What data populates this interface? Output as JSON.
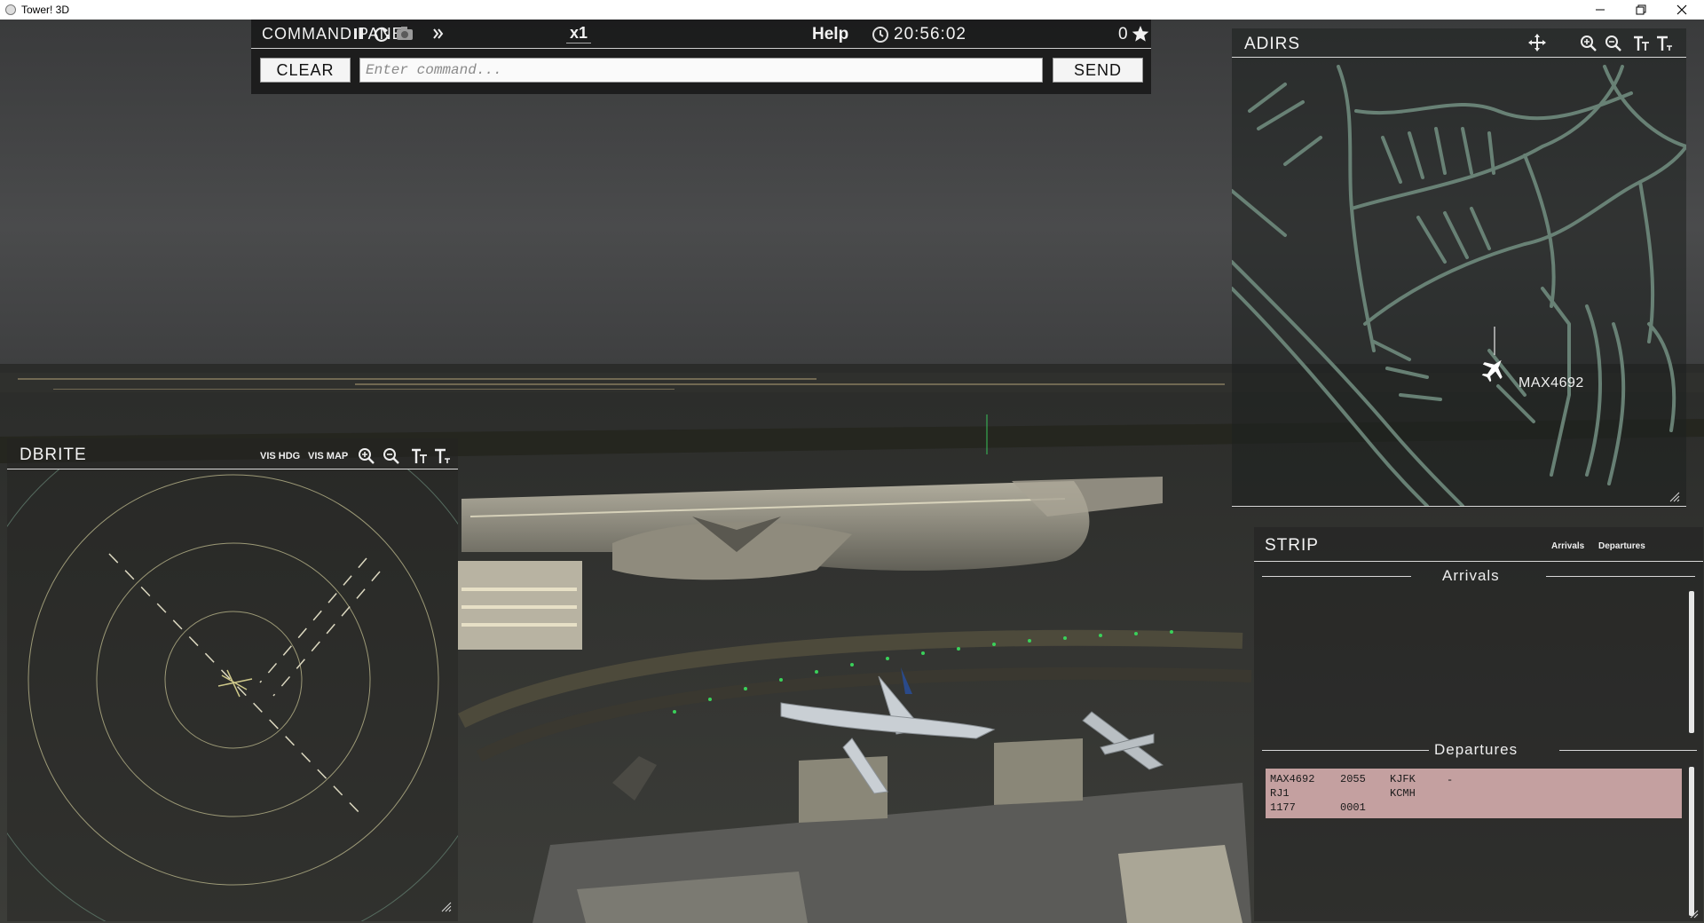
{
  "window": {
    "title": "Tower! 3D",
    "controls": [
      "minimize-icon",
      "restore-icon",
      "close-icon"
    ]
  },
  "command_panel": {
    "title": "COMMAND PANEL",
    "speed": "x1",
    "help_label": "Help",
    "time": "20:56:02",
    "score": "0",
    "clear_label": "CLEAR",
    "send_label": "SEND",
    "input_placeholder": "Enter command...",
    "input_value": ""
  },
  "dbrite": {
    "title": "DBRITE",
    "vis_hdg_label": "VIS HDG",
    "vis_map_label": "VIS MAP",
    "tools": [
      "zoom-in-icon",
      "zoom-out-icon",
      "text-larger-icon",
      "text-smaller-icon"
    ]
  },
  "adirs": {
    "title": "ADIRS",
    "tools": [
      "move-icon",
      "zoom-in-icon",
      "zoom-out-icon",
      "text-larger-icon",
      "text-smaller-icon"
    ],
    "aircraft_label": "MAX4692"
  },
  "strip": {
    "title": "STRIP",
    "tab_arrivals": "Arrivals",
    "tab_departures": "Departures",
    "arrivals_header": "Arrivals",
    "departures_header": "Departures",
    "departures": [
      {
        "callsign": "MAX4692",
        "time": "2055",
        "origin": "KJFK",
        "remark": "-",
        "type": "RJ1",
        "destination": "KCMH",
        "squawk": "1177",
        "code": "0001"
      }
    ]
  },
  "colors": {
    "panel_bg": "#161616",
    "strip_bg": "#c4a0a0",
    "map_lines": "#6f8a7d",
    "radar_lines": "#b9b58a",
    "text": "#f0f0f0"
  }
}
